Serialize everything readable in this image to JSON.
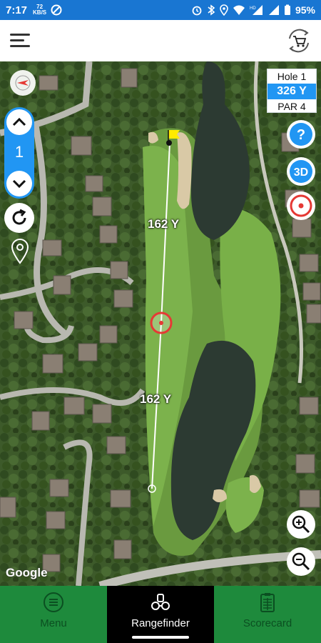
{
  "status_bar": {
    "time": "7:17",
    "net_speed": "72",
    "net_unit": "KB/S",
    "battery": "95%"
  },
  "hole_stepper": {
    "hole": "1"
  },
  "hole_card": {
    "hole_label": "Hole 1",
    "yards": "326 Y",
    "par": "PAR 4"
  },
  "buttons": {
    "help": "?",
    "threed": "3D"
  },
  "distances": {
    "upper": "162 Y",
    "lower": "162 Y"
  },
  "map": {
    "attribution": "Google"
  },
  "bottom_nav": {
    "items": [
      {
        "label": "Menu",
        "icon": "menu-circle-icon"
      },
      {
        "label": "Rangefinder",
        "icon": "rangefinder-icon"
      },
      {
        "label": "Scorecard",
        "icon": "scorecard-icon"
      }
    ],
    "active": "Rangefinder"
  },
  "colors": {
    "status_bar": "#1976d2",
    "accent_blue": "#2196f3",
    "nav_green": "#1e8a3c",
    "target_red": "#e53935",
    "flag_yellow": "#ffeb00"
  }
}
